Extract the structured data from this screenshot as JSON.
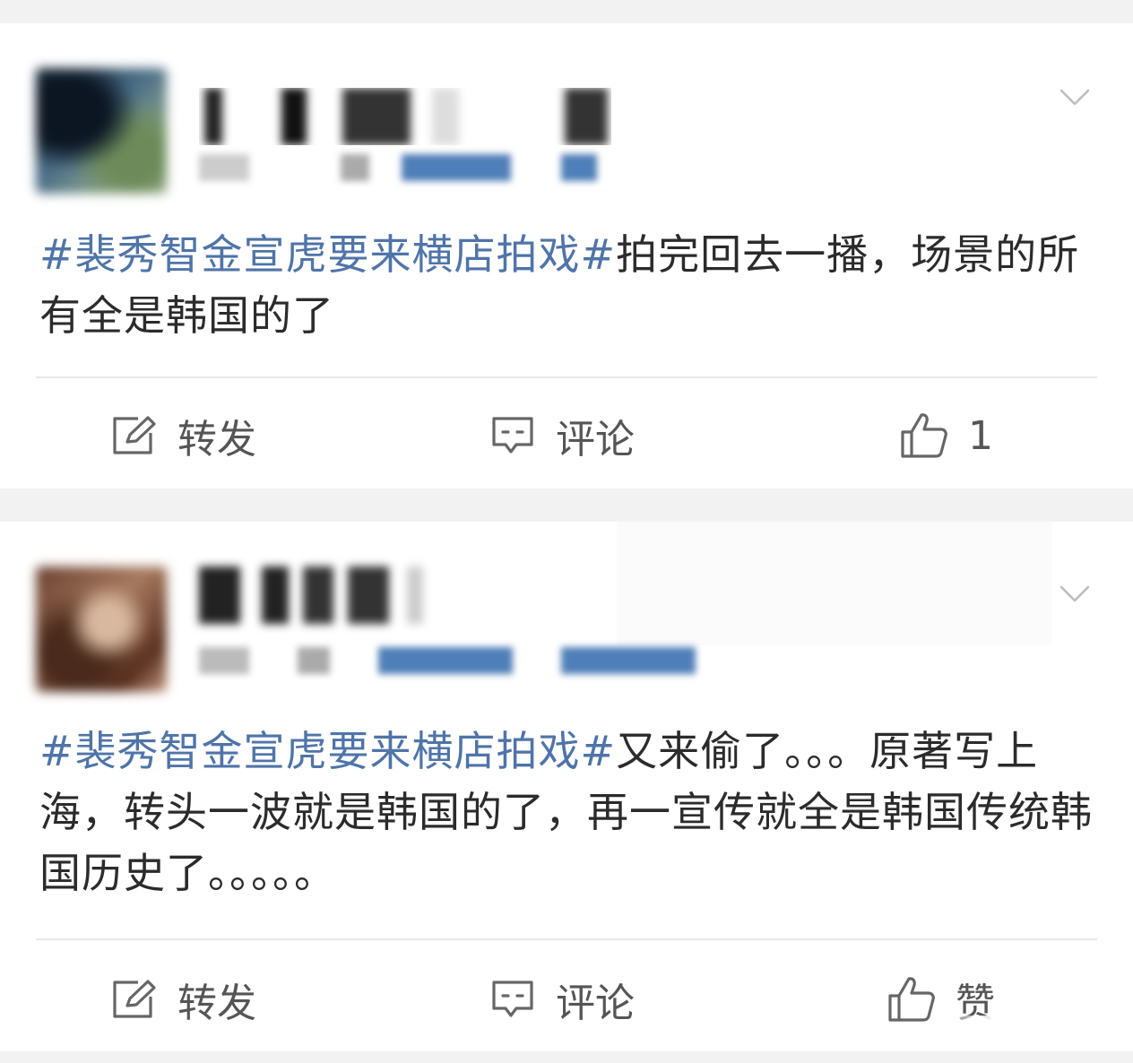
{
  "posts": [
    {
      "hashtag": "#裴秀智金宣虎要来横店拍戏#",
      "text": "拍完回去一播，场景的所有全是韩国的了",
      "actions": {
        "repost_label": "转发",
        "comment_label": "评论",
        "like_label": "1"
      }
    },
    {
      "hashtag": "#裴秀智金宣虎要来横店拍戏#",
      "text": "又来偷了。。。原著写上海，转头一波就是韩国的了，再一宣传就全是韩国传统韩国历史了。。。。。",
      "actions": {
        "repost_label": "转发",
        "comment_label": "评论",
        "like_label": "赞"
      }
    }
  ],
  "colors": {
    "hashtag": "#4f74a8",
    "text": "#2b2b2b",
    "icon": "#666666",
    "background": "#f2f2f2",
    "card": "#ffffff"
  },
  "icons": {
    "repost": "edit-square-icon",
    "comment": "comment-bubble-icon",
    "like": "thumbs-up-icon",
    "menu": "chevron-down-icon"
  }
}
